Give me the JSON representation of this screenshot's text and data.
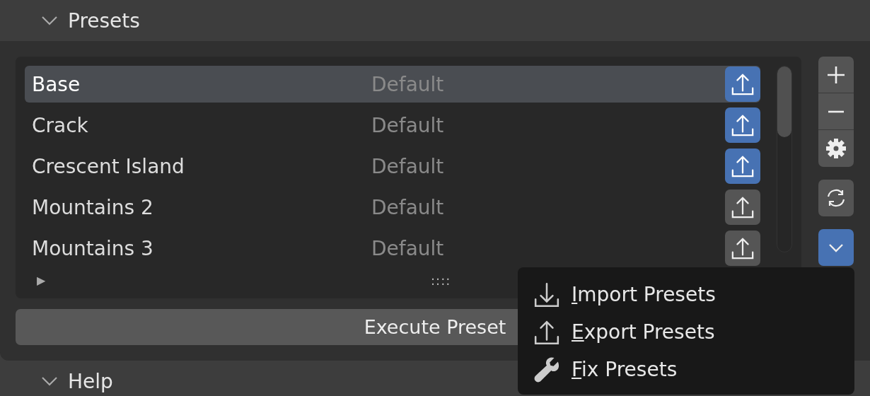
{
  "presets_panel": {
    "title": "Presets",
    "expanded": true
  },
  "list": {
    "rows": [
      {
        "name": "Base",
        "tag": "Default",
        "selected": true,
        "export_active": true
      },
      {
        "name": "Crack",
        "tag": "Default",
        "selected": false,
        "export_active": true
      },
      {
        "name": "Crescent Island",
        "tag": "Default",
        "selected": false,
        "export_active": true
      },
      {
        "name": "Mountains 2",
        "tag": "Default",
        "selected": false,
        "export_active": false
      },
      {
        "name": "Mountains 3",
        "tag": "Default",
        "selected": false,
        "export_active": false
      }
    ],
    "filter_toggle": "▶",
    "resize_grip": "::::"
  },
  "side_buttons": [
    {
      "kind": "add"
    },
    {
      "kind": "remove"
    },
    {
      "kind": "settings"
    },
    {
      "kind": "refresh"
    },
    {
      "kind": "dropdown",
      "open": true
    }
  ],
  "execute_button": "Execute Preset",
  "menu": {
    "items": [
      {
        "kind": "import",
        "label": "Import Presets"
      },
      {
        "kind": "export",
        "label": "Export Presets"
      },
      {
        "kind": "fix",
        "label": "Fix Presets"
      }
    ]
  },
  "help_panel": {
    "title": "Help",
    "expanded": true
  }
}
